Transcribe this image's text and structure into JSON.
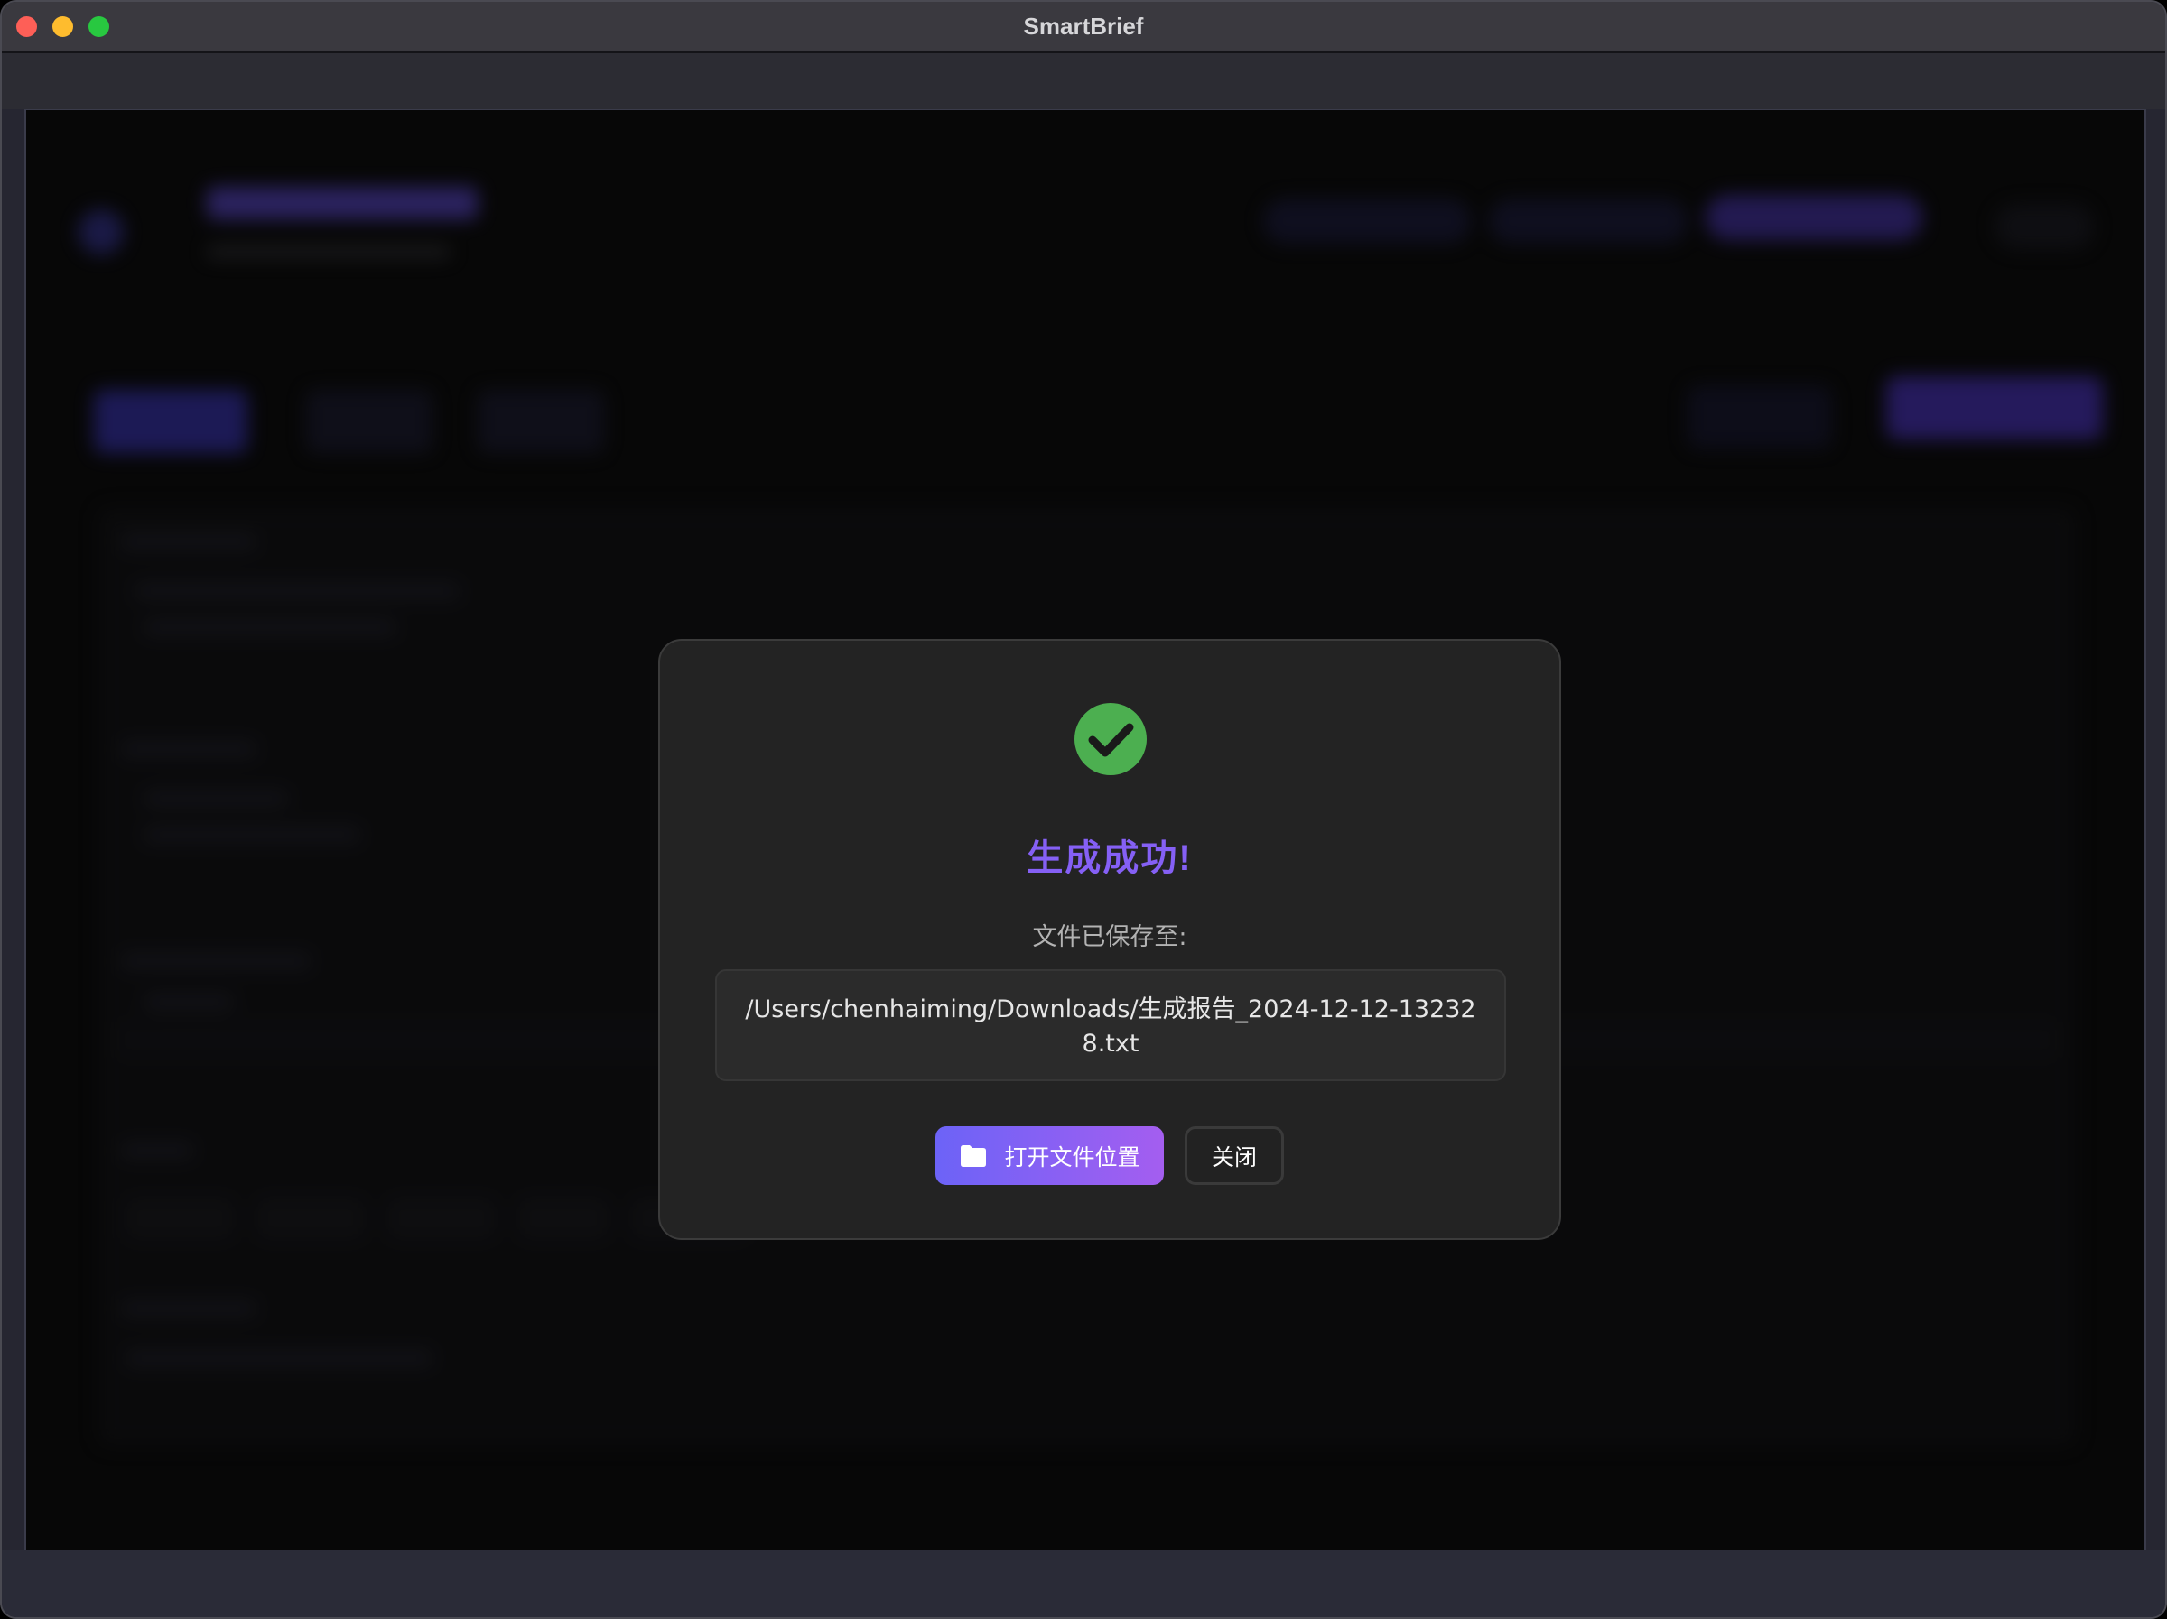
{
  "window": {
    "title": "SmartBrief"
  },
  "dialog": {
    "icon": "check-circle-icon",
    "title": "生成成功!",
    "subtitle": "文件已保存至:",
    "file_path": "/Users/chenhaiming/Downloads/生成报告_2024-12-12-132328.txt",
    "open_button_label": "打开文件位置",
    "open_button_icon": "folder-icon",
    "close_button_label": "关闭"
  },
  "colors": {
    "accent": "#8560f5",
    "success": "#4caf50",
    "button_gradient_start": "#6c63f7",
    "button_gradient_end": "#a45ef0",
    "dialog_bg": "#232323"
  }
}
